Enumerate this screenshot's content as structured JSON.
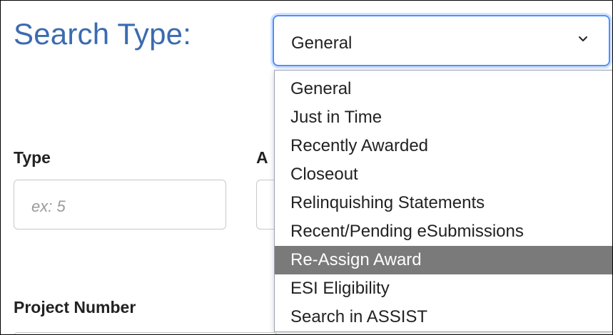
{
  "search": {
    "label": "Search Type:",
    "selected_value": "General",
    "options": [
      "General",
      "Just in Time",
      "Recently Awarded",
      "Closeout",
      "Relinquishing Statements",
      "Recent/Pending eSubmissions",
      "Re-Assign Award",
      "ESI Eligibility",
      "Search in ASSIST"
    ],
    "highlighted_option": "Re-Assign Award"
  },
  "fields": {
    "type_label": "Type",
    "type_placeholder": "ex: 5",
    "a_label": "A",
    "project_number_label": "Project Number"
  },
  "colors": {
    "label_blue": "#3b6bb0",
    "focus_border": "#4d90fe",
    "highlight_bg": "#7a7a7a"
  },
  "icons": {
    "dropdown_chevron": "chevron-down-icon"
  }
}
